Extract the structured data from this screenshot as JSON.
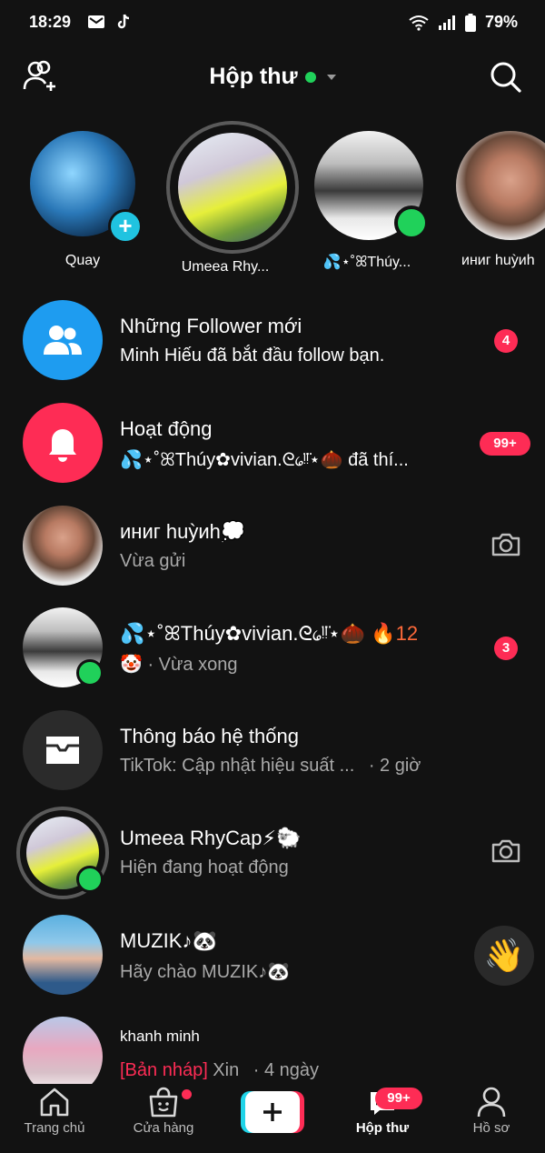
{
  "status_bar": {
    "time": "18:29",
    "battery": "79%"
  },
  "header": {
    "title": "Hộp thư"
  },
  "stories": [
    {
      "name": "Quay"
    },
    {
      "name": "Umeea Rhy..."
    },
    {
      "name": "💦⋆˚ꕤThúy..."
    },
    {
      "name": "иниг huỳиh"
    }
  ],
  "inbox": [
    {
      "title": "Những Follower mới",
      "subtitle": "Minh Hiếu đã bắt đầu follow bạn.",
      "badge": "4"
    },
    {
      "title": "Hoạt động",
      "subtitle": "💦⋆˚ꕤThúy✿vivian.ᘓ᥀ᵎ̈ᵎ̈⋆🌰 đã thí...",
      "badge": "99+"
    },
    {
      "title": "иниг huỳиh💭",
      "subtitle": "Vừa gửi"
    },
    {
      "title": "💦⋆˚ꕤThúy✿vivian.ᘓ᥀ᵎ̈ᵎ̈⋆🌰",
      "streak": "🔥12",
      "subtitle_emoji": "🤡",
      "subtitle": " · Vừa xong",
      "badge": "3"
    },
    {
      "title": "Thông báo hệ thống",
      "subtitle": "TikTok: Cập nhật hiệu suất ...",
      "time": "· 2 giờ"
    },
    {
      "title": "Umeea RhyCap⚡🐑",
      "subtitle": "Hiện đang hoạt động"
    },
    {
      "title": "MUZIK♪🐼",
      "subtitle": "Hãy chào MUZIK♪🐼",
      "wave": "👋"
    },
    {
      "title": "khanh minh",
      "draft": "[Bản nháp]",
      "subtitle": " Xin",
      "time": "· 4 ngày"
    }
  ],
  "bottom_nav": {
    "home": "Trang chủ",
    "shop": "Cửa hàng",
    "inbox": "Hộp thư",
    "inbox_badge": "99+",
    "profile": "Hồ sơ"
  },
  "colors": {
    "accent": "#fe2c55",
    "online": "#20d15a",
    "cyan": "#20c3e0",
    "follower_blue": "#1e9cf0"
  }
}
